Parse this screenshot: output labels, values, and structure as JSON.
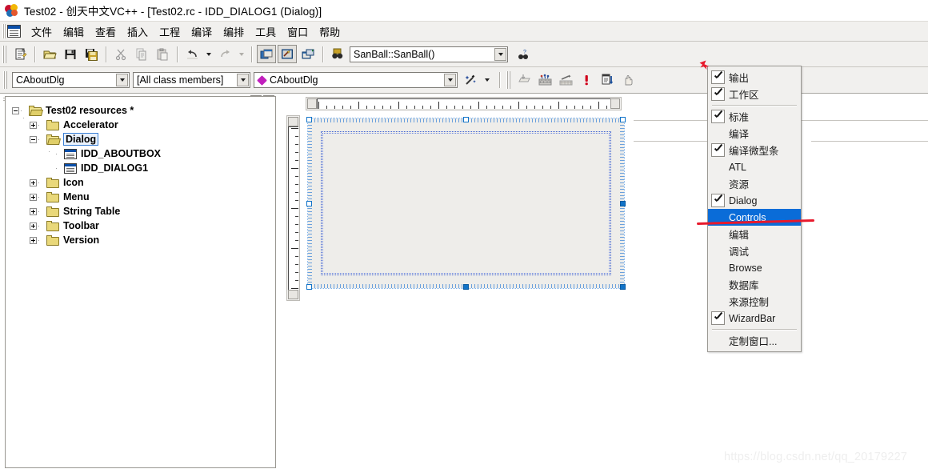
{
  "window": {
    "title": "Test02 - 创天中文VC++ - [Test02.rc - IDD_DIALOG1 (Dialog)]",
    "app_icon": "vcpp-colorballs-icon"
  },
  "menubar": {
    "doc_icon": "mdi-document-icon",
    "items": [
      {
        "label": "文件"
      },
      {
        "label": "编辑"
      },
      {
        "label": "查看"
      },
      {
        "label": "插入"
      },
      {
        "label": "工程"
      },
      {
        "label": "编译"
      },
      {
        "label": "编排"
      },
      {
        "label": "工具"
      },
      {
        "label": "窗口"
      },
      {
        "label": "帮助"
      }
    ]
  },
  "toolbar_standard": {
    "buttons": [
      {
        "name": "new-text-file-button",
        "icon": "new-document-icon"
      },
      {
        "name": "open-button",
        "icon": "open-folder-icon"
      },
      {
        "name": "save-button",
        "icon": "floppy-save-icon"
      },
      {
        "name": "save-all-button",
        "icon": "save-all-icon"
      },
      {
        "name": "cut-button",
        "icon": "scissors-icon"
      },
      {
        "name": "copy-button",
        "icon": "copy-icon"
      },
      {
        "name": "paste-button",
        "icon": "paste-icon"
      },
      {
        "name": "undo-button",
        "icon": "undo-arrow-icon"
      },
      {
        "name": "undo-dropdown-button",
        "icon": "chevron-down-icon"
      },
      {
        "name": "redo-button",
        "icon": "redo-arrow-icon"
      },
      {
        "name": "redo-dropdown-button",
        "icon": "chevron-down-icon"
      },
      {
        "name": "workspace-button",
        "icon": "workspace-window-icon"
      },
      {
        "name": "output-button",
        "icon": "output-window-icon"
      },
      {
        "name": "window-list-button",
        "icon": "window-list-icon"
      },
      {
        "name": "find-in-files-button",
        "icon": "binoculars-find-icon"
      }
    ],
    "find_combo": {
      "value": "SanBall::SanBall()",
      "placeholder": "",
      "dropdown_icon": "chevron-down-icon"
    },
    "help_button": {
      "name": "search-help-button",
      "icon": "question-binoculars-icon"
    }
  },
  "toolbar_wizardbar": {
    "class_combo": {
      "value": "CAboutDlg",
      "dropdown_icon": "chevron-down-icon"
    },
    "filter_combo": {
      "value": "[All class members]",
      "dropdown_icon": "chevron-down-icon"
    },
    "member_combo": {
      "value": "CAboutDlg",
      "bullet_icon": "magenta-diamond-icon",
      "dropdown_icon": "chevron-down-icon"
    },
    "action_button": {
      "name": "wizard-wand-button",
      "icon": "magic-wand-icon"
    },
    "action_dropdown": {
      "name": "wizard-dropdown-button",
      "icon": "chevron-down-icon"
    },
    "build_buttons": [
      {
        "name": "compile-button",
        "icon": "compile-icon"
      },
      {
        "name": "build-button",
        "icon": "build-bricks-icon"
      },
      {
        "name": "stop-build-button",
        "icon": "stop-build-icon"
      },
      {
        "name": "execute-program-button",
        "icon": "red-exclamation-icon"
      },
      {
        "name": "go-button",
        "icon": "go-arrow-icon"
      },
      {
        "name": "insert-breakpoint-button",
        "icon": "hand-icon"
      }
    ]
  },
  "workspace": {
    "minimize_button": {
      "name": "workspace-restore-button",
      "icon": "triangle-up-icon"
    },
    "close_button": {
      "name": "workspace-close-button",
      "icon": "close-x-icon",
      "label": "x"
    },
    "tree": [
      {
        "label": "Test02 resources *",
        "icon": "open-folder-icon",
        "expander": "minus",
        "level": 0,
        "bold": true,
        "selected": false
      },
      {
        "label": "Accelerator",
        "icon": "folder-icon",
        "expander": "plus",
        "level": 1,
        "bold": true,
        "selected": false
      },
      {
        "label": "Dialog",
        "icon": "open-folder-icon",
        "expander": "minus",
        "level": 1,
        "bold": true,
        "selected": true
      },
      {
        "label": "IDD_ABOUTBOX",
        "icon": "dialog-resource-icon",
        "expander": "none",
        "level": 2,
        "bold": true,
        "selected": false
      },
      {
        "label": "IDD_DIALOG1",
        "icon": "dialog-resource-icon",
        "expander": "none",
        "level": 2,
        "bold": true,
        "selected": false
      },
      {
        "label": "Icon",
        "icon": "folder-icon",
        "expander": "plus",
        "level": 1,
        "bold": true,
        "selected": false
      },
      {
        "label": "Menu",
        "icon": "folder-icon",
        "expander": "plus",
        "level": 1,
        "bold": true,
        "selected": false
      },
      {
        "label": "String Table",
        "icon": "folder-icon",
        "expander": "plus",
        "level": 1,
        "bold": true,
        "selected": false
      },
      {
        "label": "Toolbar",
        "icon": "folder-icon",
        "expander": "plus",
        "level": 1,
        "bold": true,
        "selected": false
      },
      {
        "label": "Version",
        "icon": "folder-icon",
        "expander": "plus",
        "level": 1,
        "bold": true,
        "selected": false
      }
    ]
  },
  "editor": {
    "name": "dialog-resource-editor",
    "horizontal_ruler": "horizontal-ruler",
    "vertical_ruler": "vertical-ruler",
    "dialog_preview": {
      "name": "dialog-design-surface",
      "selected": true,
      "handles": 8
    }
  },
  "popup_menu": {
    "name": "toolbars-context-menu",
    "items": [
      {
        "label": "输出",
        "checked": true,
        "separator_after": false
      },
      {
        "label": "工作区",
        "checked": true,
        "separator_after": true
      },
      {
        "label": "标准",
        "checked": true,
        "separator_after": false
      },
      {
        "label": "编译",
        "checked": false,
        "separator_after": false
      },
      {
        "label": "编译微型条",
        "checked": true,
        "separator_after": false
      },
      {
        "label": "ATL",
        "checked": false,
        "separator_after": false
      },
      {
        "label": "资源",
        "checked": false,
        "separator_after": false
      },
      {
        "label": "Dialog",
        "checked": true,
        "separator_after": false
      },
      {
        "label": "Controls",
        "checked": false,
        "highlighted": true,
        "separator_after": false
      },
      {
        "label": "编辑",
        "checked": false,
        "separator_after": false
      },
      {
        "label": "调试",
        "checked": false,
        "separator_after": false
      },
      {
        "label": "Browse",
        "checked": false,
        "separator_after": false
      },
      {
        "label": "数据库",
        "checked": false,
        "separator_after": false
      },
      {
        "label": "来源控制",
        "checked": false,
        "separator_after": false
      },
      {
        "label": "WizardBar",
        "checked": true,
        "separator_after": true
      },
      {
        "label": "定制窗口...",
        "checked": false,
        "separator_after": false
      }
    ]
  },
  "annotations": {
    "arrow": {
      "name": "red-pointer-annotation",
      "color": "#e8192c"
    },
    "underline": {
      "name": "red-underline-annotation",
      "color": "#e8192c"
    }
  },
  "watermark": {
    "text": "https://blog.csdn.net/qq_20179227"
  },
  "colors": {
    "accent": "#0a6cd8",
    "chrome": "#f1f0ee",
    "annotation": "#e8192c"
  }
}
